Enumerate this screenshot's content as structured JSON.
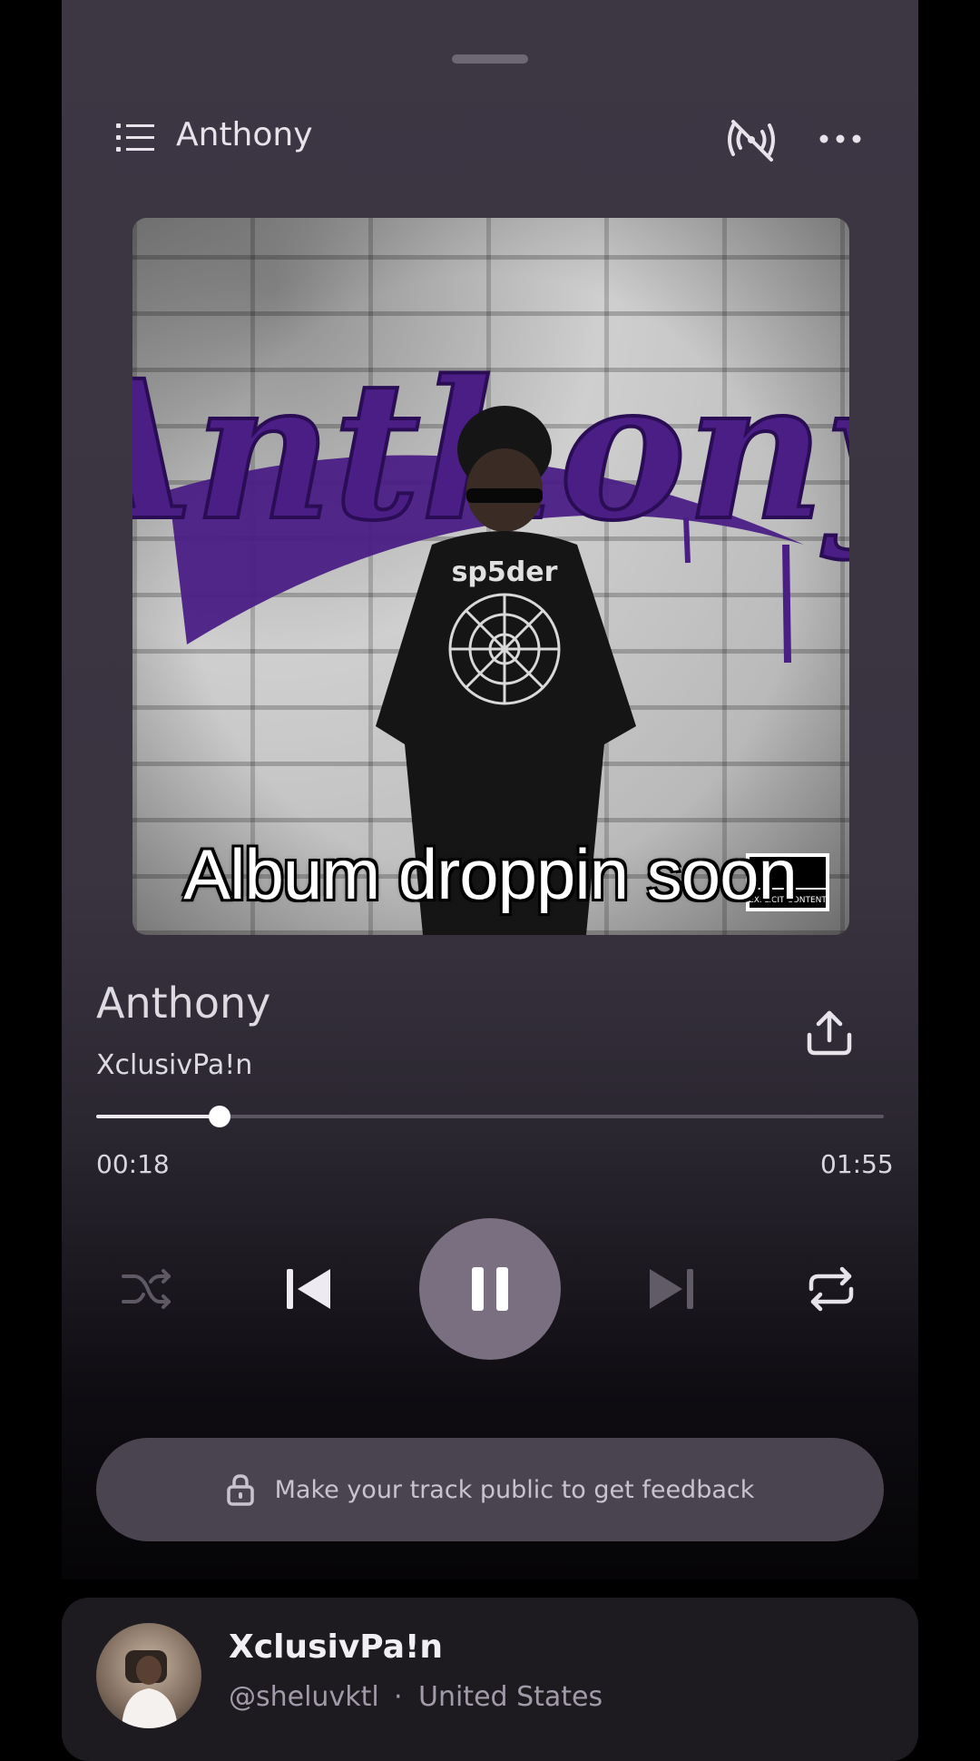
{
  "header": {
    "title": "Anthony",
    "queue_icon": "queue-list-icon",
    "cast_icon": "cast-off-icon",
    "more_icon": "more-horizontal-icon"
  },
  "cover": {
    "art_text": "Anthony",
    "subtitle": "Album droppin soon",
    "advisory": "EXPLICIT CONTENT"
  },
  "track": {
    "title": "Anthony",
    "artist": "XclusivPa!n",
    "share_icon": "share-upload-icon"
  },
  "player": {
    "current_time": "00:18",
    "total_time": "01:55",
    "progress_fraction": 0.1565,
    "state": "playing",
    "controls": [
      "shuffle-icon",
      "previous-icon",
      "pause-icon",
      "next-icon",
      "repeat-icon"
    ]
  },
  "feedback": {
    "label": "Make your track public to get feedback",
    "icon": "lock-icon"
  },
  "artist_card": {
    "name": "XclusivPa!n",
    "handle": "@sheluvktl",
    "separator": "·",
    "country": "United States"
  },
  "colors": {
    "sheet_top": "#3d3744",
    "accent_purple": "#4b1e86",
    "play_button": "#7a6f80",
    "feedback_button": "#4a4350"
  }
}
